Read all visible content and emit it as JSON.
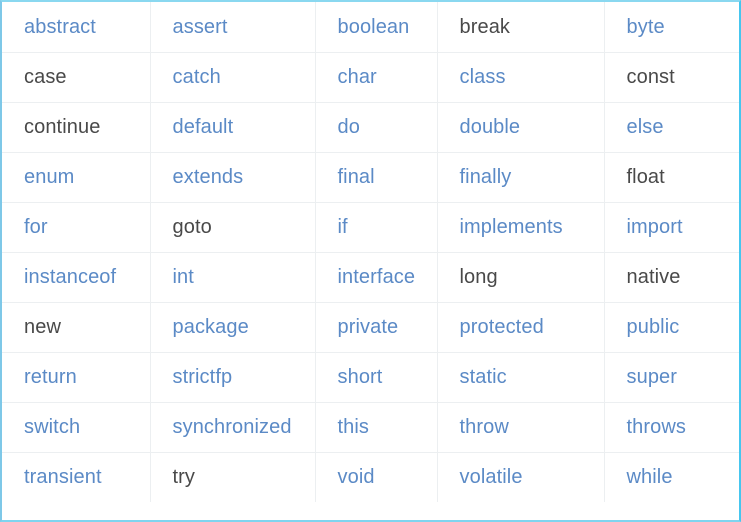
{
  "page": {
    "title": "Java Keywords Table",
    "border_color": "#7fd4ef",
    "link_color": "#5b8ac6",
    "plain_color": "#494949",
    "grid_color": "#eceff1",
    "background": "#ffffff",
    "columns": 5,
    "rows": 10
  },
  "table": {
    "rows": [
      [
        {
          "label": "abstract",
          "style": "link"
        },
        {
          "label": "assert",
          "style": "link"
        },
        {
          "label": "boolean",
          "style": "link"
        },
        {
          "label": "break",
          "style": "plain"
        },
        {
          "label": "byte",
          "style": "link"
        }
      ],
      [
        {
          "label": "case",
          "style": "plain"
        },
        {
          "label": "catch",
          "style": "link"
        },
        {
          "label": "char",
          "style": "link"
        },
        {
          "label": "class",
          "style": "link"
        },
        {
          "label": "const",
          "style": "plain"
        }
      ],
      [
        {
          "label": "continue",
          "style": "plain"
        },
        {
          "label": "default",
          "style": "link"
        },
        {
          "label": "do",
          "style": "link"
        },
        {
          "label": "double",
          "style": "link"
        },
        {
          "label": "else",
          "style": "link"
        }
      ],
      [
        {
          "label": "enum",
          "style": "link"
        },
        {
          "label": "extends",
          "style": "link"
        },
        {
          "label": "final",
          "style": "link"
        },
        {
          "label": "finally",
          "style": "link"
        },
        {
          "label": "float",
          "style": "plain"
        }
      ],
      [
        {
          "label": "for",
          "style": "link"
        },
        {
          "label": "goto",
          "style": "plain"
        },
        {
          "label": "if",
          "style": "link"
        },
        {
          "label": "implements",
          "style": "link"
        },
        {
          "label": "import",
          "style": "link"
        }
      ],
      [
        {
          "label": "instanceof",
          "style": "link"
        },
        {
          "label": "int",
          "style": "link"
        },
        {
          "label": "interface",
          "style": "link"
        },
        {
          "label": "long",
          "style": "plain"
        },
        {
          "label": "native",
          "style": "plain"
        }
      ],
      [
        {
          "label": "new",
          "style": "plain"
        },
        {
          "label": "package",
          "style": "link"
        },
        {
          "label": "private",
          "style": "link"
        },
        {
          "label": "protected",
          "style": "link"
        },
        {
          "label": "public",
          "style": "link"
        }
      ],
      [
        {
          "label": "return",
          "style": "link"
        },
        {
          "label": "strictfp",
          "style": "link"
        },
        {
          "label": "short",
          "style": "link"
        },
        {
          "label": "static",
          "style": "link"
        },
        {
          "label": "super",
          "style": "link"
        }
      ],
      [
        {
          "label": "switch",
          "style": "link"
        },
        {
          "label": "synchronized",
          "style": "link"
        },
        {
          "label": "this",
          "style": "link"
        },
        {
          "label": "throw",
          "style": "link"
        },
        {
          "label": "throws",
          "style": "link"
        }
      ],
      [
        {
          "label": "transient",
          "style": "link"
        },
        {
          "label": "try",
          "style": "plain"
        },
        {
          "label": "void",
          "style": "link"
        },
        {
          "label": "volatile",
          "style": "link"
        },
        {
          "label": "while",
          "style": "link"
        }
      ]
    ]
  }
}
